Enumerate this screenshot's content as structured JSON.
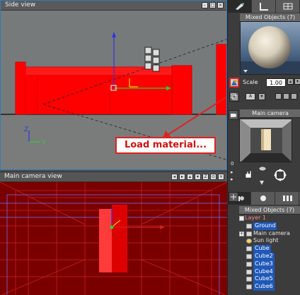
{
  "side_view": {
    "title": "Side view",
    "buttons": [
      "-",
      "□",
      "×"
    ],
    "axis_labels": {
      "z": "Z",
      "y": "Y"
    }
  },
  "camera_view": {
    "title": "Main camera view",
    "buttons": [
      "◂",
      "▸",
      "▴",
      "▾",
      "Z",
      "⊙",
      "×"
    ]
  },
  "right_panel": {
    "material_header": "Mixed Objects (7)",
    "scale_label": "Scale",
    "scale_value": "1.00",
    "ab_label": "A",
    "camera_header": "Main camera",
    "nav_zero": "0",
    "objects_header": "Mixed Objects (7)",
    "tree": [
      {
        "label": "Layer 1",
        "selected": false,
        "expander": ""
      },
      {
        "label": "Ground",
        "selected": true,
        "expander": ""
      },
      {
        "label": "Main camera",
        "selected": false,
        "expander": "+"
      },
      {
        "label": "Sun light",
        "selected": false,
        "expander": ""
      },
      {
        "label": "Cube",
        "selected": true,
        "expander": ""
      },
      {
        "label": "Cube2",
        "selected": true,
        "expander": ""
      },
      {
        "label": "Cube3",
        "selected": true,
        "expander": ""
      },
      {
        "label": "Cube4",
        "selected": true,
        "expander": ""
      },
      {
        "label": "Cube5",
        "selected": true,
        "expander": ""
      },
      {
        "label": "Cube6",
        "selected": true,
        "expander": ""
      }
    ]
  },
  "annotation": {
    "text": "Load material..."
  },
  "colors": {
    "accent_red": "#dd2222",
    "selection_blue": "#1f58b8",
    "object_red": "#ff0000"
  }
}
